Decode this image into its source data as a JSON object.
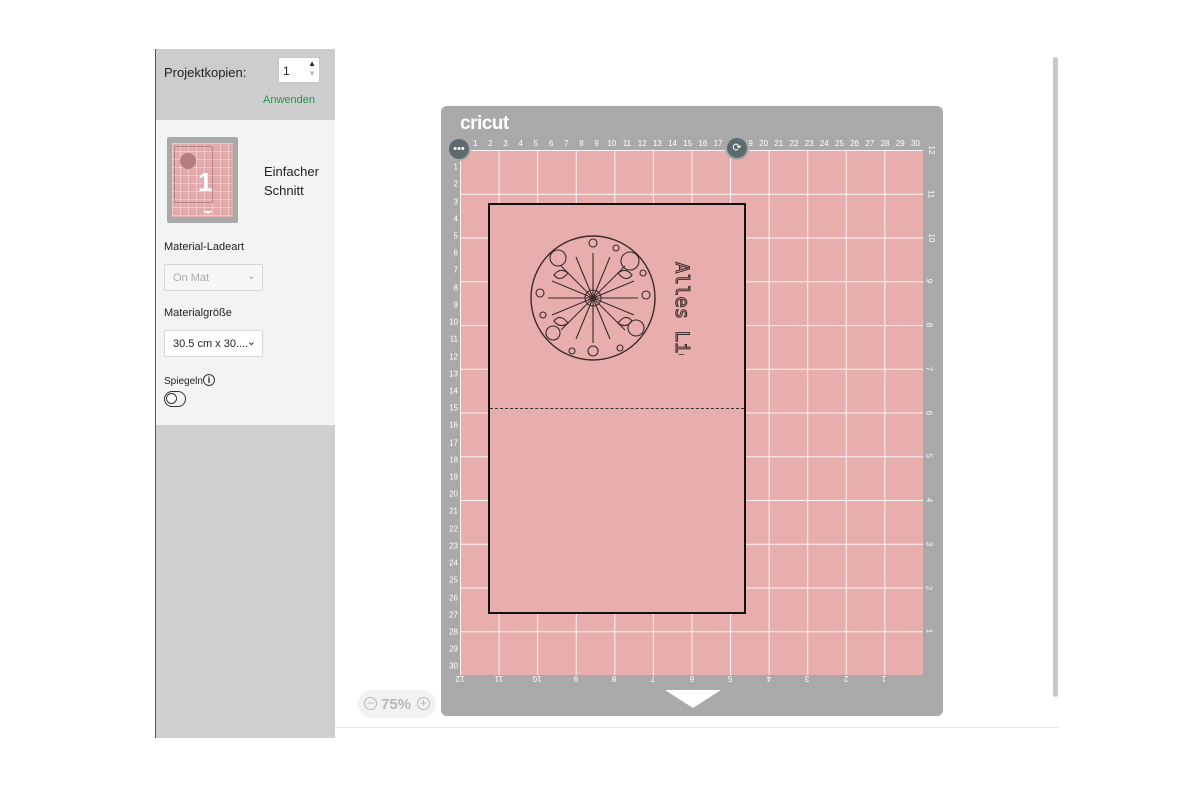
{
  "sidebar": {
    "copies_label": "Projektkopien:",
    "copies_value": "1",
    "apply_label": "Anwenden",
    "mat_thumb_number": "1",
    "cut_title": "Einfacher Schnitt",
    "load_type_label": "Material-Ladeart",
    "load_type_value": "On Mat",
    "material_size_label": "Materialgröße",
    "material_size_value": "30.5 cm x 30....",
    "mirror_label": "Spiegeln",
    "mirror_on": false
  },
  "mat": {
    "logo": "cricut",
    "card_text": "Alles Liebe",
    "top_ruler": [
      "1",
      "2",
      "3",
      "4",
      "5",
      "6",
      "7",
      "8",
      "9",
      "10",
      "11",
      "12",
      "13",
      "14",
      "15",
      "16",
      "17",
      "18",
      "19",
      "20",
      "21",
      "22",
      "23",
      "24",
      "25",
      "26",
      "27",
      "28",
      "29",
      "30"
    ],
    "left_ruler": [
      "1",
      "2",
      "3",
      "4",
      "5",
      "6",
      "7",
      "8",
      "9",
      "10",
      "11",
      "12",
      "13",
      "14",
      "15",
      "16",
      "17",
      "18",
      "19",
      "20",
      "21",
      "22",
      "23",
      "24",
      "25",
      "26",
      "27",
      "28",
      "29",
      "30"
    ],
    "bottom_ruler": [
      "12",
      "11",
      "10",
      "9",
      "8",
      "7",
      "6",
      "5",
      "4",
      "3",
      "2",
      "1"
    ],
    "right_ruler": [
      "12",
      "11",
      "10",
      "9",
      "8",
      "7",
      "6",
      "5",
      "4",
      "3",
      "2",
      "1"
    ]
  },
  "canvas": {
    "zoom_value": "75%"
  },
  "colors": {
    "mat_pink": "#e8aeae",
    "mat_frame": "#a9a9a9",
    "accent_green": "#1e9a4f",
    "sidebar_gray": "#cfcfcf"
  },
  "icons": {
    "more": "more-options-icon",
    "rotate": "rotate-icon",
    "info": "info-icon",
    "zoom_in": "zoom-in-icon",
    "zoom_out": "zoom-out-icon"
  }
}
